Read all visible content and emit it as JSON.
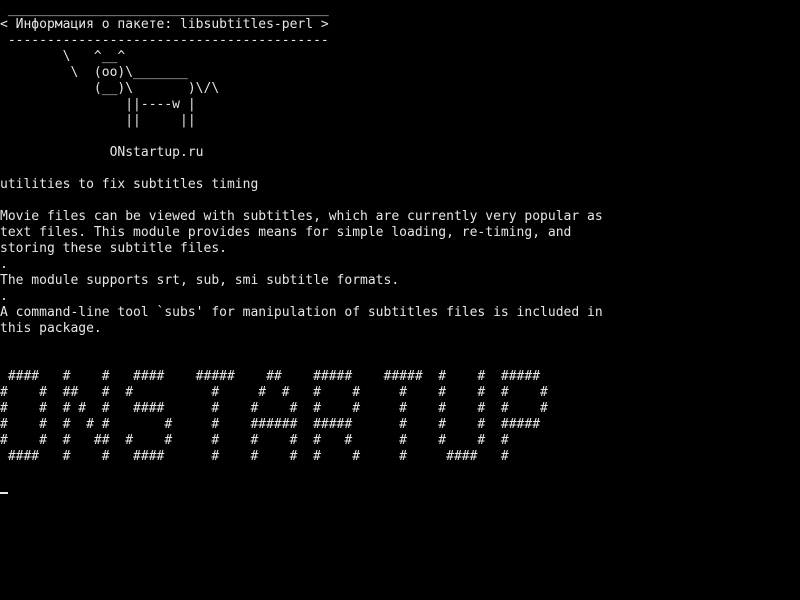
{
  "colors": {
    "background": "#000000",
    "foreground": "#e6e6e6"
  },
  "speech_bubble": {
    "top_border": " _________________________________________",
    "text": "< Информация о пакете: libsubtitles-perl >",
    "bottom_border": " -----------------------------------------"
  },
  "cow": [
    "        \\   ^__^",
    "         \\  (oo)\\_______",
    "            (__)\\       )\\/\\",
    "                ||----w |",
    "                ||     ||"
  ],
  "site_label": "              ONstartup.ru",
  "package": {
    "summary": "utilities to fix subtitles timing",
    "description_lines": [
      "Movie files can be viewed with subtitles, which are currently very popular as",
      "text files. This module provides means for simple loading, re-timing, and",
      "storing these subtitle files.",
      ".",
      "The module supports srt, sub, smi subtitle formats.",
      ".",
      "A command-line tool `subs' for manipulation of subtitles files is included in",
      "this package."
    ]
  },
  "banner": [
    " ####   #    #   ####    #####    ##    #####    #####  #    #  #####",
    "#    #  ##   #  #          #     #  #   #    #     #    #    #  #    #",
    "#    #  # #  #   ####      #    #    #  #    #     #    #    #  #    #",
    "#    #  #  # #       #     #    ######  #####      #    #    #  #####",
    "#    #  #   ##  #    #     #    #    #  #   #      #    #    #  #",
    " ####   #    #   ####      #    #    #  #    #     #     ####   #"
  ],
  "cursor_char": "_"
}
